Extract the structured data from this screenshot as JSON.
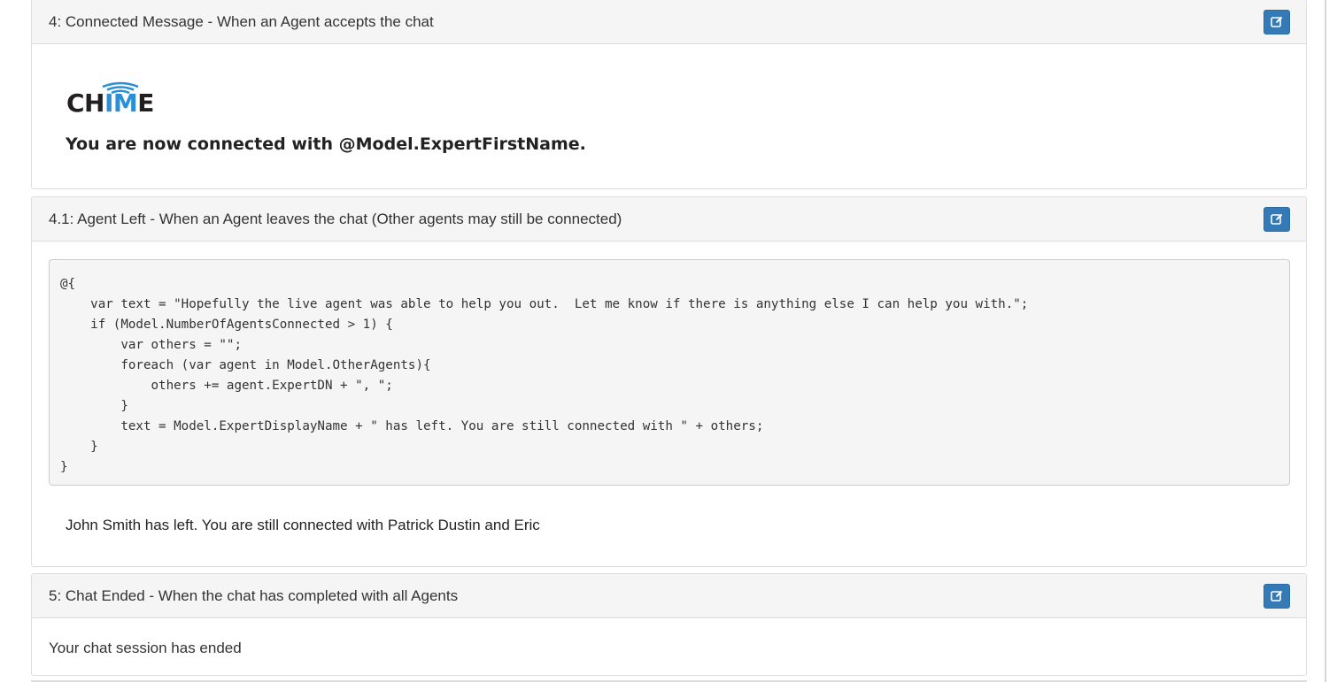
{
  "panels": {
    "connected": {
      "title": "4: Connected Message - When an Agent accepts the chat",
      "logo_text_dark_1": "CH",
      "logo_text_blue": "IM",
      "logo_text_dark_2": "E",
      "message": "You are now connected with @Model.ExpertFirstName."
    },
    "agent_left": {
      "title": "4.1: Agent Left - When an Agent leaves the chat (Other agents may still be connected)",
      "code": "@{\n    var text = \"Hopefully the live agent was able to help you out.  Let me know if there is anything else I can help you with.\";\n    if (Model.NumberOfAgentsConnected > 1) {\n        var others = \"\";\n        foreach (var agent in Model.OtherAgents){\n            others += agent.ExpertDN + \", \";\n        }\n        text = Model.ExpertDisplayName + \" has left. You are still connected with \" + others;\n    }\n}",
      "preview": "John Smith has left. You are still connected with Patrick Dustin and Eric"
    },
    "chat_ended": {
      "title": "5: Chat Ended - When the chat has completed with all Agents",
      "message": "Your chat session has ended"
    }
  },
  "icons": {
    "edit": "edit-icon",
    "logo_waves": "wifi-waves-icon"
  },
  "colors": {
    "edit_button": "#337ab7",
    "logo_blue": "#2a8fd6",
    "logo_dark": "#231f20",
    "panel_heading": "#f5f5f5",
    "code_background": "#f5f5f5"
  }
}
